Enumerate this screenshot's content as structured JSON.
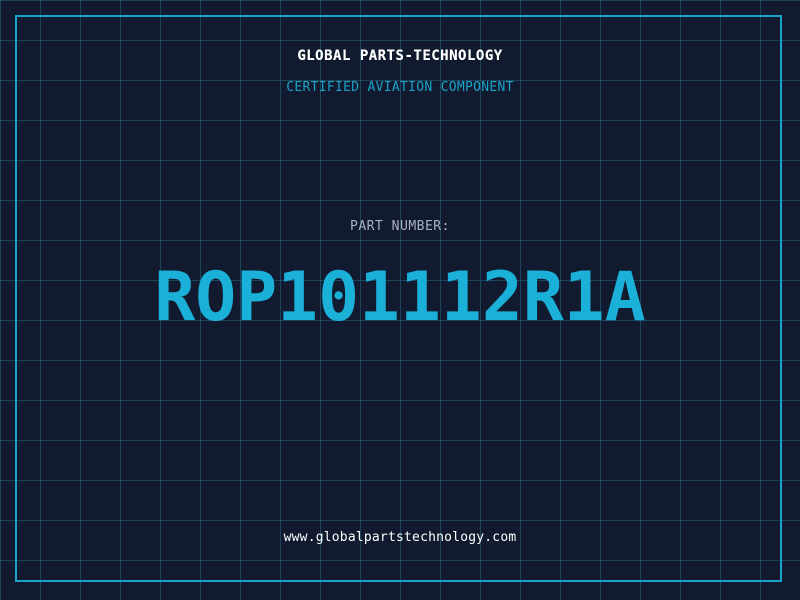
{
  "header": {
    "company": "GLOBAL PARTS-TECHNOLOGY",
    "subtitle": "CERTIFIED AVIATION COMPONENT"
  },
  "part": {
    "label": "PART NUMBER:",
    "number": "ROP101112R1A"
  },
  "footer": {
    "url": "www.globalpartstechnology.com"
  },
  "colors": {
    "background": "#111a2e",
    "grid": "#28789a",
    "accent": "#1aa3c9",
    "part_number": "#1ab0d8",
    "text_primary": "#ffffff",
    "text_muted": "#aab3c2"
  }
}
